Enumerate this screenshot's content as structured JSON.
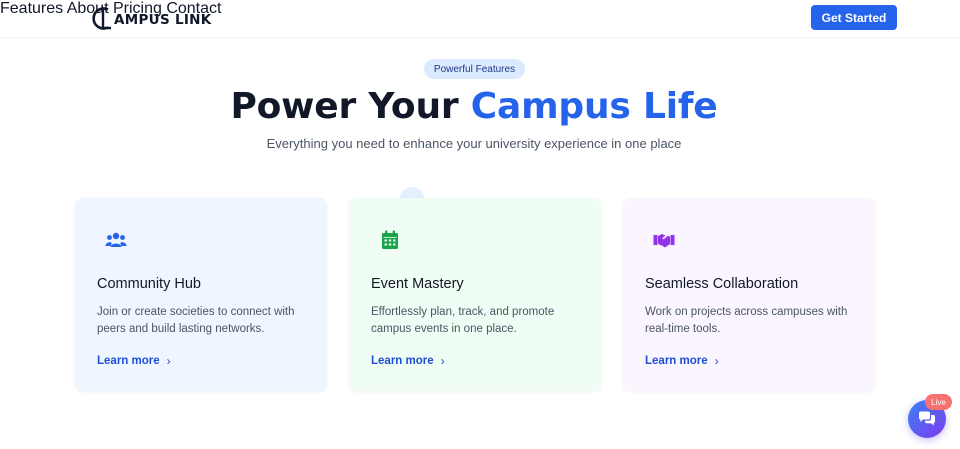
{
  "brand": {
    "name": "AMPUS LINK"
  },
  "nav": {
    "items": [
      {
        "label": "Features"
      },
      {
        "label": "About"
      },
      {
        "label": "Pricing"
      },
      {
        "label": "Contact"
      }
    ],
    "cta_label": "Get Started"
  },
  "hero": {
    "badge": "Powerful Features",
    "title_plain": "Power Your ",
    "title_accent": "Campus Life",
    "subtitle": "Everything you need to enhance your university experience in one place"
  },
  "cards": [
    {
      "icon": "users-icon",
      "title": "Community Hub",
      "description": "Join or create societies to connect with peers and build lasting networks.",
      "link": "Learn more",
      "chevron": "›",
      "bg": "#eff6ff",
      "icon_color": "#2563eb"
    },
    {
      "icon": "calendar-icon",
      "title": "Event Mastery",
      "description": "Effortlessly plan, track, and promote campus events in one place.",
      "link": "Learn more",
      "chevron": "›",
      "bg": "#f0fdf4",
      "icon_color": "#16a34a"
    },
    {
      "icon": "handshake-icon",
      "title": "Seamless Collaboration",
      "description": "Work on projects across campuses with real-time tools.",
      "link": "Learn more",
      "chevron": "›",
      "bg": "#faf5ff",
      "icon_color": "#9333ea"
    }
  ],
  "chat": {
    "badge": "Live"
  },
  "colors": {
    "primary": "#2563eb",
    "text": "#111827",
    "muted": "#4b5563"
  }
}
